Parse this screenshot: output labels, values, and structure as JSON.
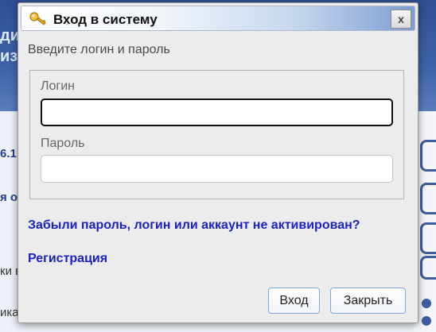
{
  "background": {
    "header_fragments": [
      "ди",
      "из"
    ],
    "snippets": [
      "6.1",
      "я об",
      "ки в",
      "ика"
    ]
  },
  "dialog": {
    "title": "Вход в систему",
    "title_icon": "key-icon",
    "close_label": "x",
    "instructions": "Введите логин и пароль",
    "login_label": "Логин",
    "login_value": "",
    "password_label": "Пароль",
    "password_value": "",
    "forgot_link": "Забыли пароль, логин или аккаунт не активирован?",
    "register_link": "Регистрация",
    "login_button": "Вход",
    "close_button": "Закрыть"
  },
  "colors": {
    "link": "#1a22c4",
    "button_border": "#7ea9d8",
    "background_header": "#2f4f93"
  }
}
